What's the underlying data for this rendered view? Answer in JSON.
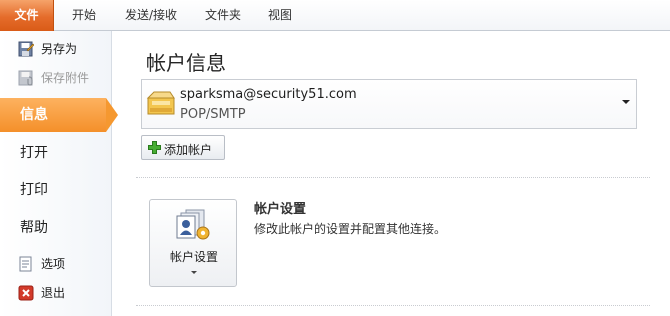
{
  "ribbon": {
    "tabs": [
      {
        "label": "文件"
      },
      {
        "label": "开始"
      },
      {
        "label": "发送/接收"
      },
      {
        "label": "文件夹"
      },
      {
        "label": "视图"
      }
    ]
  },
  "nav": {
    "commands_top": [
      {
        "label": "另存为",
        "icon": "save-as-icon"
      },
      {
        "label": "保存附件",
        "icon": "save-attachments-icon",
        "disabled": true
      }
    ],
    "tabs": [
      {
        "label": "信息",
        "selected": true
      },
      {
        "label": "打开"
      },
      {
        "label": "打印"
      },
      {
        "label": "帮助"
      }
    ],
    "commands_bottom": [
      {
        "label": "选项",
        "icon": "options-icon"
      },
      {
        "label": "退出",
        "icon": "exit-icon"
      }
    ]
  },
  "main": {
    "heading": "帐户信息",
    "account": {
      "email": "sparksma@security51.com",
      "protocol": "POP/SMTP"
    },
    "add_account_label": "添加帐户",
    "account_settings": {
      "button_label": "帐户设置",
      "title": "帐户设置",
      "description": "修改此帐户的设置并配置其他连接。"
    }
  },
  "colors": {
    "file_tab": "#e56c2b",
    "selected_nav": "#f59830",
    "add_plus": "#3a9b2b",
    "exit_red": "#d23a2a"
  }
}
